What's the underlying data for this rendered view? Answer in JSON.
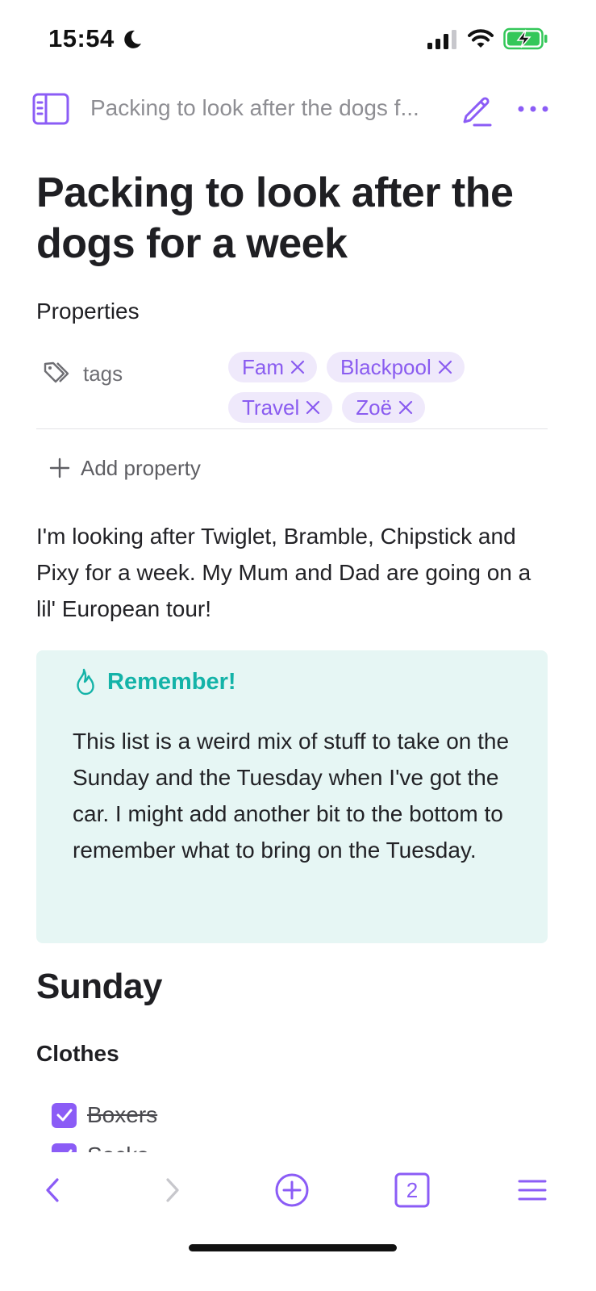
{
  "status_bar": {
    "time": "15:54",
    "icons": [
      "moon-icon",
      "cellular-signal-icon",
      "wifi-icon",
      "battery-charging-icon"
    ],
    "battery_color": "#34c759"
  },
  "toolbar": {
    "title": "Packing to look after the dogs f...",
    "icons": [
      "sidebar-icon",
      "pencil-icon",
      "more-icon"
    ]
  },
  "page": {
    "title": "Packing to look after the dogs for a week",
    "properties_heading": "Properties",
    "property": {
      "label": "tags",
      "icon": "tag-icon",
      "tags": [
        "Fam",
        "Blackpool",
        "Travel",
        "Zoë"
      ]
    },
    "add_property_label": "Add property",
    "intro": "I'm looking after Twiglet, Bramble, Chipstick and Pixy for a week. My Mum and Dad are going on a lil' European tour!",
    "callout": {
      "icon": "flame-icon",
      "title": "Remember!",
      "body": "This list is a weird mix of stuff to take on the Sunday and the Tuesday when I've got the car. I might add another bit to the bottom to remember what to bring on the Tuesday.",
      "background": "#e6f6f4",
      "accent": "#14b3a8"
    },
    "section_heading": "Sunday",
    "subsection_heading": "Clothes",
    "todos": [
      {
        "text": "Boxers",
        "checked": true
      },
      {
        "text": "Socks",
        "checked": true
      }
    ]
  },
  "bottom_nav": {
    "icons": [
      "back-arrow-icon",
      "forward-arrow-icon",
      "add-circle-icon",
      "tabs-icon",
      "menu-icon"
    ],
    "tab_count": "2"
  },
  "colors": {
    "accent": "#8b5cf6",
    "tag_bg": "#efe9fb",
    "text": "#222226",
    "muted": "#8e8e93"
  }
}
